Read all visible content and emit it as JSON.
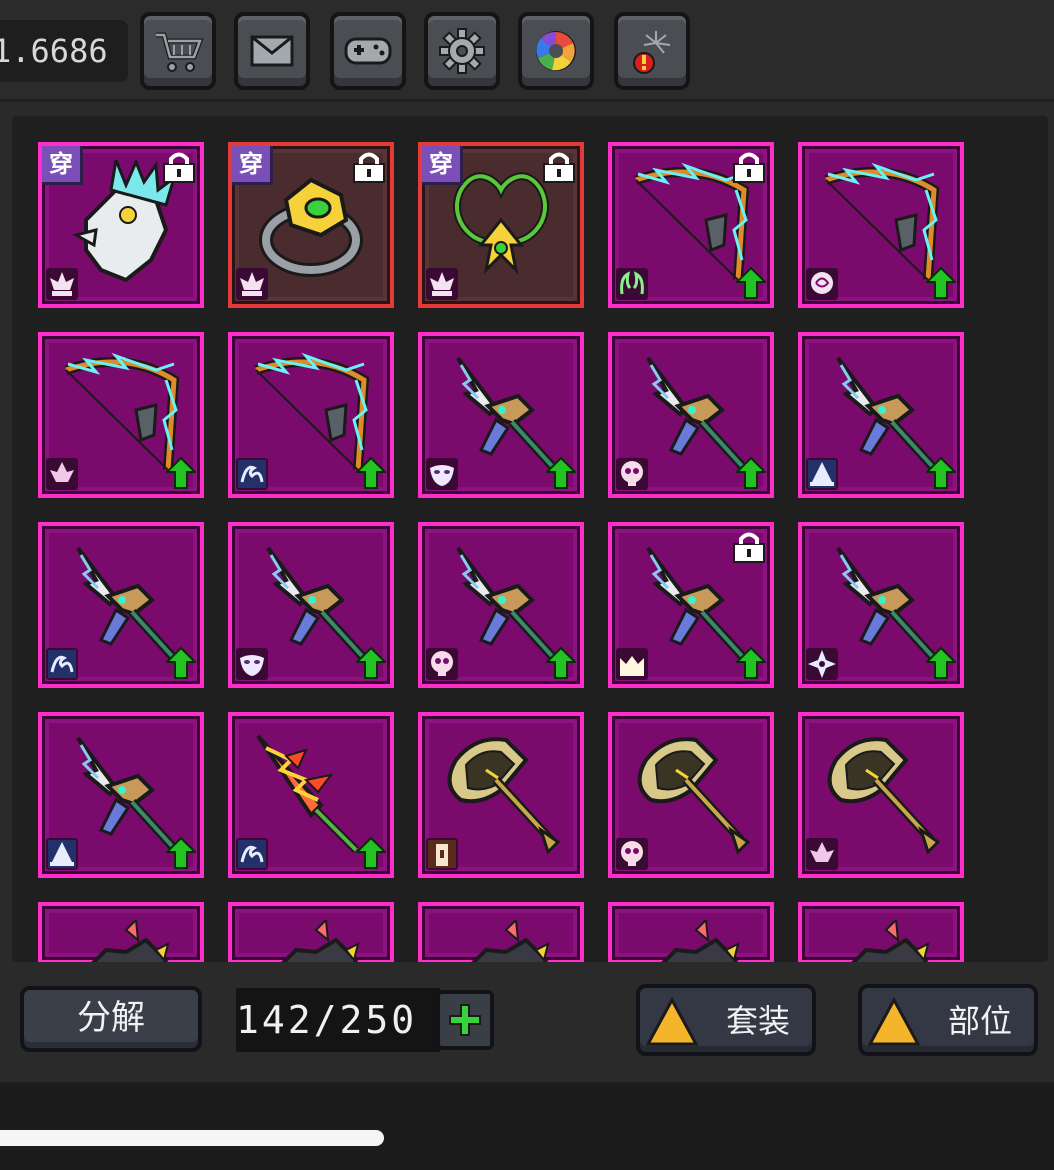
{
  "header": {
    "currency_value": "1.6686",
    "buttons": [
      {
        "name": "shop",
        "icon": "cart-icon"
      },
      {
        "name": "mail",
        "icon": "envelope-icon"
      },
      {
        "name": "gamepad",
        "icon": "gamepad-icon"
      },
      {
        "name": "settings",
        "icon": "gear-icon"
      },
      {
        "name": "gallery",
        "icon": "aperture-icon"
      },
      {
        "name": "events",
        "icon": "fireworks-alert-icon"
      }
    ]
  },
  "inventory": {
    "wear_label": "穿",
    "colors": {
      "epic_bg": "#7a0a6c",
      "epic_border": "#ff2ec8",
      "equipped_border": "#e43a3a",
      "upgrade": "#22c322"
    },
    "rows": [
      [
        {
          "item": "bone-helmet",
          "equipped": true,
          "locked": true,
          "upgrade": false,
          "set": "lotus-set-icon",
          "frame": "epic"
        },
        {
          "item": "gold-ring",
          "equipped": true,
          "locked": true,
          "upgrade": false,
          "set": "lotus-set-icon",
          "frame": "equipped"
        },
        {
          "item": "vine-necklace",
          "equipped": true,
          "locked": true,
          "upgrade": false,
          "set": "lotus-set-icon",
          "frame": "equipped"
        },
        {
          "item": "lightning-bow",
          "equipped": false,
          "locked": true,
          "upgrade": true,
          "set": "horns-set-icon",
          "frame": "epic"
        },
        {
          "item": "lightning-bow",
          "equipped": false,
          "locked": false,
          "upgrade": true,
          "set": "rose-set-icon",
          "frame": "epic"
        }
      ],
      [
        {
          "item": "lightning-bow",
          "equipped": false,
          "locked": false,
          "upgrade": true,
          "set": "flower-set-icon",
          "frame": "epic"
        },
        {
          "item": "lightning-bow",
          "equipped": false,
          "locked": false,
          "upgrade": true,
          "set": "wave-set-icon",
          "frame": "epic"
        },
        {
          "item": "jagged-sword",
          "equipped": false,
          "locked": false,
          "upgrade": true,
          "set": "mask-set-icon",
          "frame": "epic"
        },
        {
          "item": "jagged-sword",
          "equipped": false,
          "locked": false,
          "upgrade": true,
          "set": "skull-set-icon",
          "frame": "epic"
        },
        {
          "item": "jagged-sword",
          "equipped": false,
          "locked": false,
          "upgrade": true,
          "set": "hat-set-icon",
          "frame": "epic"
        }
      ],
      [
        {
          "item": "jagged-sword",
          "equipped": false,
          "locked": false,
          "upgrade": true,
          "set": "wave-set-icon",
          "frame": "epic"
        },
        {
          "item": "jagged-sword",
          "equipped": false,
          "locked": false,
          "upgrade": true,
          "set": "mask-set-icon",
          "frame": "epic"
        },
        {
          "item": "jagged-sword",
          "equipped": false,
          "locked": false,
          "upgrade": true,
          "set": "skull-set-icon",
          "frame": "epic"
        },
        {
          "item": "jagged-sword",
          "equipped": false,
          "locked": true,
          "upgrade": true,
          "set": "crown-set-icon",
          "frame": "epic"
        },
        {
          "item": "jagged-sword",
          "equipped": false,
          "locked": false,
          "upgrade": true,
          "set": "shuriken-set-icon",
          "frame": "epic"
        }
      ],
      [
        {
          "item": "jagged-sword",
          "equipped": false,
          "locked": false,
          "upgrade": true,
          "set": "hat-set-icon",
          "frame": "epic"
        },
        {
          "item": "flame-sword",
          "equipped": false,
          "locked": false,
          "upgrade": true,
          "set": "wave-set-icon",
          "frame": "epic"
        },
        {
          "item": "golden-axe",
          "equipped": false,
          "locked": false,
          "upgrade": false,
          "set": "tower-set-icon",
          "frame": "epic"
        },
        {
          "item": "golden-axe",
          "equipped": false,
          "locked": false,
          "upgrade": false,
          "set": "skull-set-icon",
          "frame": "epic"
        },
        {
          "item": "golden-axe",
          "equipped": false,
          "locked": false,
          "upgrade": false,
          "set": "flower-set-icon",
          "frame": "epic"
        }
      ],
      [
        {
          "item": "dragon-claw",
          "frame": "epic"
        },
        {
          "item": "dragon-claw",
          "frame": "epic"
        },
        {
          "item": "dragon-claw",
          "frame": "epic"
        },
        {
          "item": "dragon-claw",
          "frame": "epic"
        },
        {
          "item": "dragon-claw",
          "frame": "epic"
        }
      ]
    ]
  },
  "footer": {
    "decompose_label": "分解",
    "capacity": "142/250",
    "capacity_used": 142,
    "capacity_max": 250,
    "add_icon": "plus-icon",
    "filter_set_label": "套装",
    "filter_slot_label": "部位"
  }
}
